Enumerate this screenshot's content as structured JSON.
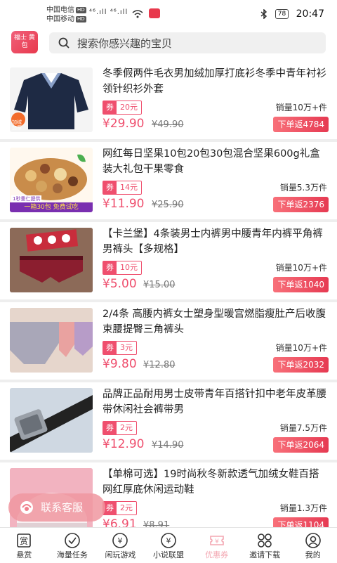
{
  "status_bar": {
    "carrier1": "中国电信",
    "carrier2": "中国移动",
    "hd": "HD",
    "signals": "⁴⁶.ıll ⁴⁶.ıll",
    "battery": "78",
    "time": "20:47"
  },
  "header": {
    "logo_text": "福士 黄包",
    "search_placeholder": "搜索你感兴趣的宝贝"
  },
  "products": [
    {
      "title": "冬季假两件毛衣男加绒加厚打底衫冬季中青年衬衫领针织衫外套",
      "coupon_label": "券",
      "coupon_value": "20元",
      "sales": "销量10万+件",
      "price": "¥29.90",
      "original_price": "¥49.90",
      "rebate": "下单返4784"
    },
    {
      "title": "网红每日坚果10包20包30包混合坚果600g礼盒装大礼包干果零食",
      "coupon_label": "券",
      "coupon_value": "14元",
      "sales": "销量5.3万件",
      "price": "¥11.90",
      "original_price": "¥25.90",
      "rebate": "下单返2376"
    },
    {
      "title": "【卡兰堡】4条装男士内裤男中腰青年内裤平角裤男裤头【多规格】",
      "coupon_label": "券",
      "coupon_value": "10元",
      "sales": "销量10万+件",
      "price": "¥5.00",
      "original_price": "¥15.00",
      "rebate": "下单返1040"
    },
    {
      "title": "2/4条 高腰内裤女士塑身型暖宫燃脂瘦肚产后收腹束腰提臀三角裤头",
      "coupon_label": "券",
      "coupon_value": "3元",
      "sales": "销量10万+件",
      "price": "¥9.80",
      "original_price": "¥12.80",
      "rebate": "下单返2032"
    },
    {
      "title": "品牌正品耐用男士皮带青年百搭针扣中老年皮革腰带休闲社会裤带男",
      "coupon_label": "券",
      "coupon_value": "2元",
      "sales": "销量7.5万件",
      "price": "¥12.90",
      "original_price": "¥14.90",
      "rebate": "下单返2064"
    },
    {
      "title": "【单棉可选】19时尚秋冬新款透气加绒女鞋百搭网红厚底休闲运动鞋",
      "coupon_label": "券",
      "coupon_value": "2元",
      "sales": "销量1.3万件",
      "price": "¥6.91",
      "original_price": "¥8.91",
      "rebate": "下单返1104"
    }
  ],
  "thumb_text": {
    "nuts_banner": "一箱30包 免费试吃",
    "nuts_tag": "1秒重仁提供",
    "sweater_badge": "加绒加厚"
  },
  "floating_service": {
    "label": "联系客服"
  },
  "tabbar": [
    {
      "label": "悬赏",
      "icon": "reward-icon"
    },
    {
      "label": "海量任务",
      "icon": "check-circle-icon"
    },
    {
      "label": "闲玩游戏",
      "icon": "yuan-circle-icon"
    },
    {
      "label": "小说联盟",
      "icon": "yuan-circle-icon"
    },
    {
      "label": "优惠券",
      "icon": "coupon-icon"
    },
    {
      "label": "邀请下载",
      "icon": "grid-icon"
    },
    {
      "label": "我的",
      "icon": "user-icon"
    }
  ],
  "colors": {
    "accent": "#ef4f6e",
    "active_tab": "#f3a7b2"
  }
}
